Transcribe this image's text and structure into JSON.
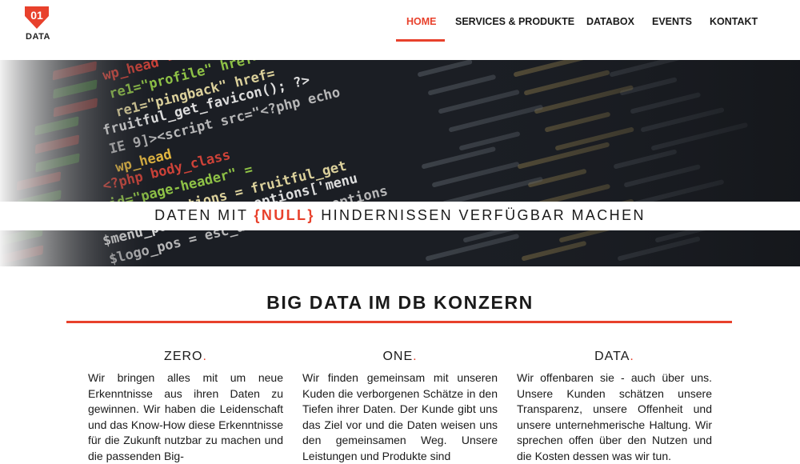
{
  "logo": {
    "text": "DATA",
    "mark": "01"
  },
  "nav": {
    "items": [
      "HOME",
      "SERVICES & PRODUKTE",
      "DATABOX",
      "EVENTS",
      "KONTAKT"
    ],
    "active": "HOME"
  },
  "hero": {
    "before": "DATEN MIT ",
    "highlight": "{NULL}",
    "after": " HINDERNISSEN VERFÜGBAR MACHEN",
    "code_lines": [
      "wp_head - <?php wp_head(); ?>",
      "re1=\"profile\" href=\"<?php",
      "re1=\"pingback\" href=",
      "fruitful_get_favicon(); ?>",
      "IE 9]><script src=\"<?php echo",
      "wp_head",
      "<?php body_class",
      "id=\"page-header\" =",
      "$theme_options = fruitful_get",
      "$menu_pos = $theme_options['menu",
      "$logo_pos = esc_attr($theme_options"
    ]
  },
  "section": {
    "title": "BIG DATA IM DB KONZERN"
  },
  "columns": [
    {
      "title": "ZERO",
      "dot": ".",
      "text": "Wir bringen alles mit um neue Erkenntnisse aus ihren Daten zu gewinnen. Wir haben die Leidenschaft und das Know-How diese Erkenntnisse für die Zukunft nutzbar zu machen und die passenden Big-"
    },
    {
      "title": "ONE",
      "dot": ".",
      "text": "Wir finden gemeinsam mit unseren Kuden die verborgenen Schätze in den Tiefen ihrer Daten. Der Kunde gibt uns das Ziel vor und die Daten weisen uns den gemeinsamen Weg. Unsere Leistungen und Produkte sind"
    },
    {
      "title": "DATA",
      "dot": ".",
      "text": "Wir offenbaren sie - auch über uns. Unsere Kunden schätzen unsere Transparenz, unsere Offenheit und unsere unternehmerische Haltung. Wir sprechen offen über den Nutzen und die Kosten dessen was wir tun."
    }
  ],
  "colors": {
    "accent": "#e8412c",
    "hero_bg": "#1b1e24"
  }
}
